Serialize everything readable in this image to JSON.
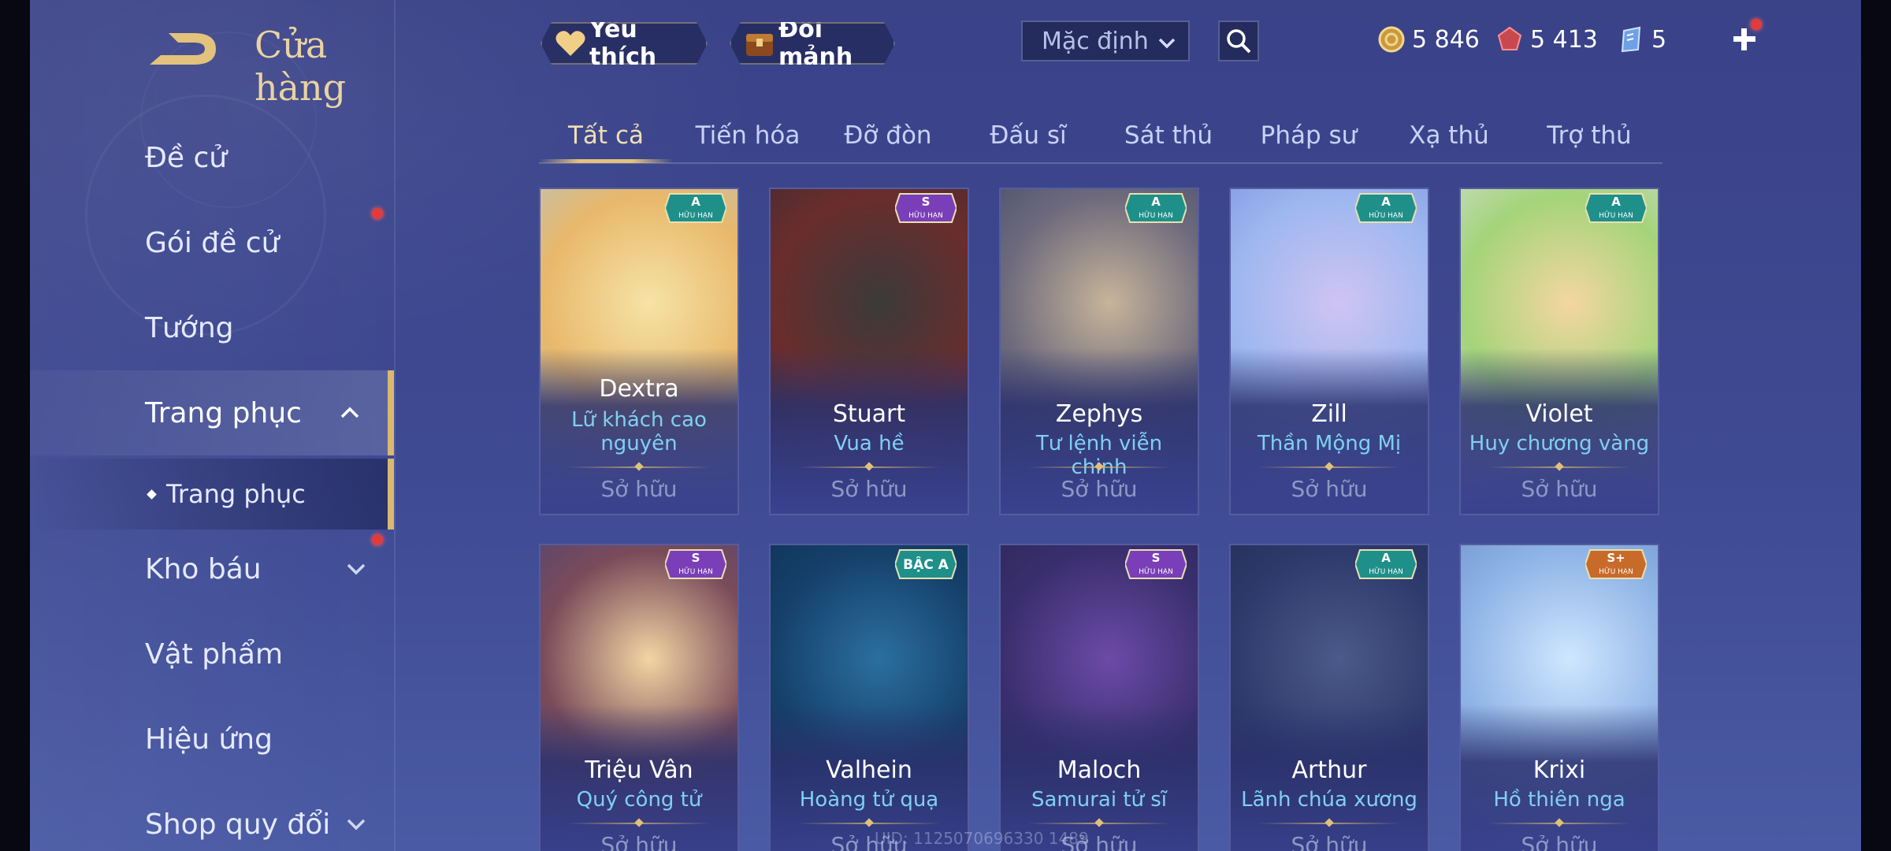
{
  "header": {
    "title": "Cửa hàng",
    "favorites_label": "Yêu thích",
    "fragments_label": "Đổi mảnh",
    "sort": {
      "selected": "Mặc định"
    },
    "currencies": [
      {
        "name": "gold-coin",
        "value": "5 846"
      },
      {
        "name": "red-gem",
        "value": "5 413"
      },
      {
        "name": "voucher",
        "value": "5"
      }
    ]
  },
  "sidebar": {
    "items": [
      {
        "label": "Đề cử"
      },
      {
        "label": "Gói đề cử",
        "notify": true
      },
      {
        "label": "Tướng"
      },
      {
        "label": "Trang phục",
        "active": true,
        "expanded": true
      },
      {
        "label": "Trang phục",
        "sub": true
      },
      {
        "label": "Kho báu",
        "notify": true
      },
      {
        "label": "Vật phẩm"
      },
      {
        "label": "Hiệu ứng"
      },
      {
        "label": "Shop quy đổi"
      }
    ]
  },
  "tabs": [
    "Tất cả",
    "Tiến hóa",
    "Đỡ đòn",
    "Đấu sĩ",
    "Sát thủ",
    "Pháp sư",
    "Xạ thủ",
    "Trợ thủ"
  ],
  "active_tab": "Tất cả",
  "cards": [
    {
      "hero": "Dextra",
      "skin": "Lữ khách cao nguyên",
      "status": "Sở hữu",
      "badge": "A",
      "badge_sub": "HỮU HẠN"
    },
    {
      "hero": "Stuart",
      "skin": "Vua hề",
      "status": "Sở hữu",
      "badge": "S",
      "badge_sub": "HỮU HẠN"
    },
    {
      "hero": "Zephys",
      "skin": "Tư lệnh viễn chinh",
      "status": "Sở hữu",
      "badge": "A",
      "badge_sub": "HỮU HẠN"
    },
    {
      "hero": "Zill",
      "skin": "Thần Mộng Mị",
      "status": "Sở hữu",
      "badge": "A",
      "badge_sub": "HỮU HẠN"
    },
    {
      "hero": "Violet",
      "skin": "Huy chương vàng",
      "status": "Sở hữu",
      "badge": "A",
      "badge_sub": "HỮU HẠN"
    },
    {
      "hero": "Triệu Vân",
      "skin": "Quý công tử",
      "status": "Sở hữu",
      "badge": "S",
      "badge_sub": "HỮU HẠN"
    },
    {
      "hero": "Valhein",
      "skin": "Hoàng tử quạ",
      "status": "Sở hữu",
      "badge": "BẬC A",
      "badge_sub": ""
    },
    {
      "hero": "Maloch",
      "skin": "Samurai tử sĩ",
      "status": "Sở hữu",
      "badge": "S",
      "badge_sub": "HỮU HẠN"
    },
    {
      "hero": "Arthur",
      "skin": "Lãnh chúa xương",
      "status": "Sở hữu",
      "badge": "A",
      "badge_sub": "HỮU HẠN"
    },
    {
      "hero": "Krixi",
      "skin": "Hồ thiên nga",
      "status": "Sở hữu",
      "badge": "S+",
      "badge_sub": "HỮU HẠN"
    }
  ],
  "uid_text": "UID: 1125070696330 1489",
  "colors": {
    "accent_gold": "#e2c27c",
    "skin_name": "#7fd0f2",
    "badge_a": "#1f8f8a",
    "badge_s": "#7a3fb8",
    "badge_splus": "#c86a2a"
  }
}
